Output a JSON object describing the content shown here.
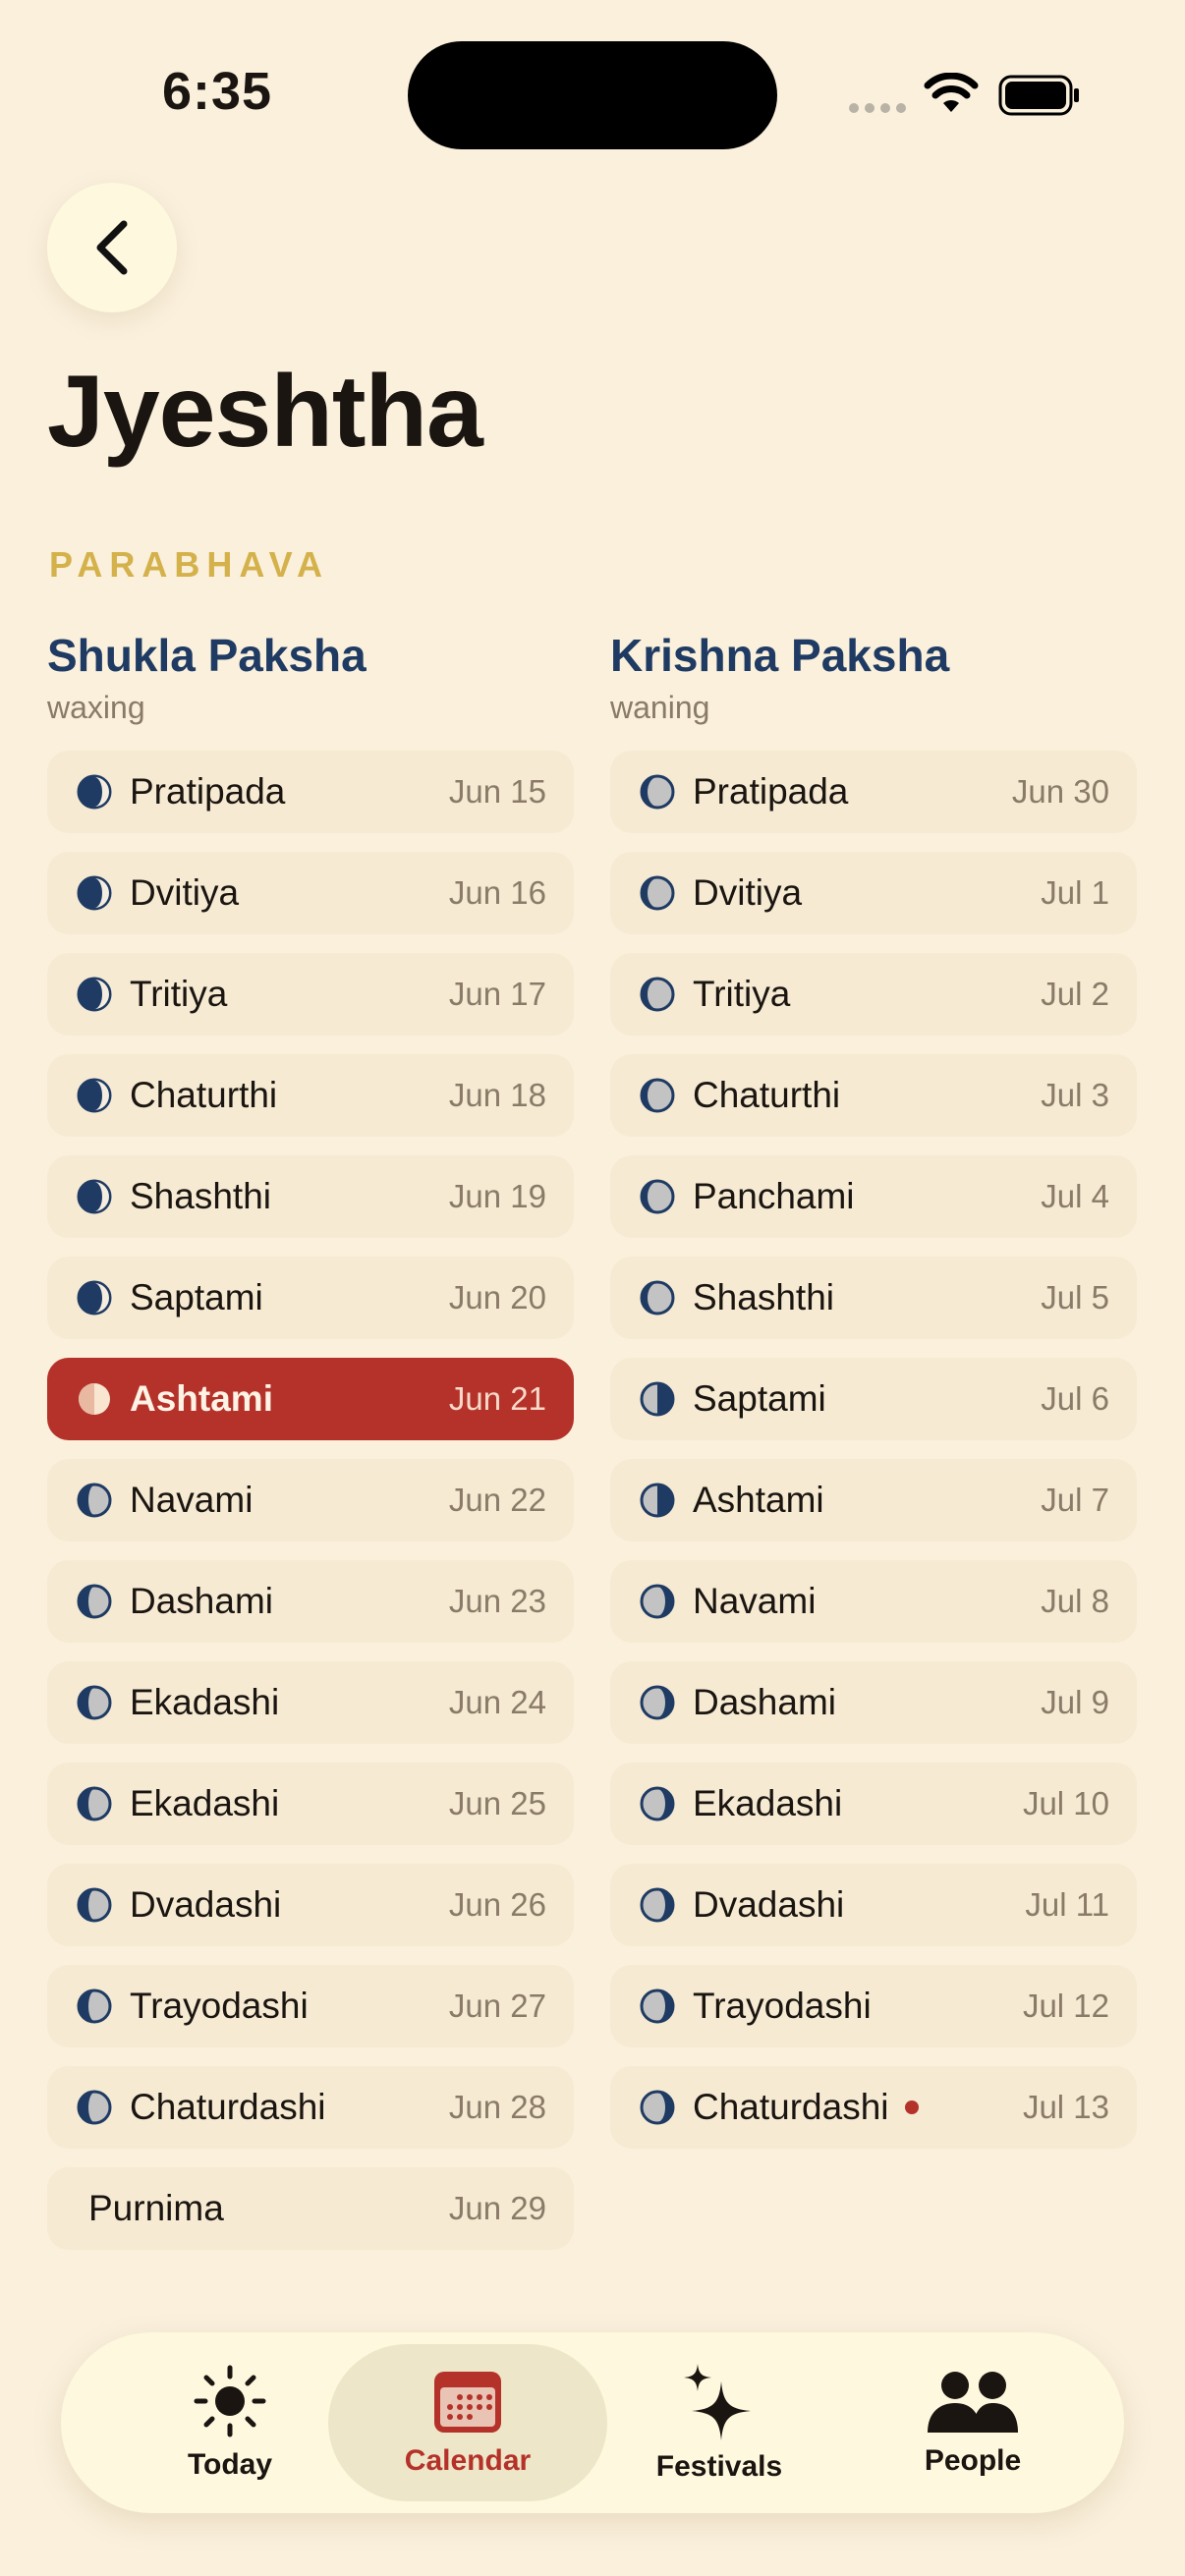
{
  "status_bar": {
    "time": "6:35"
  },
  "header": {
    "title": "Jyeshtha",
    "year_name": "PARABHAVA"
  },
  "shukla": {
    "title": "Shukla Paksha",
    "subtitle": "waxing",
    "items": [
      {
        "name": "Pratipada",
        "date": "Jun 15"
      },
      {
        "name": "Dvitiya",
        "date": "Jun 16"
      },
      {
        "name": "Tritiya",
        "date": "Jun 17"
      },
      {
        "name": "Chaturthi",
        "date": "Jun 18"
      },
      {
        "name": "Shashthi",
        "date": "Jun 19"
      },
      {
        "name": "Saptami",
        "date": "Jun 20"
      },
      {
        "name": "Ashtami",
        "date": "Jun 21"
      },
      {
        "name": "Navami",
        "date": "Jun 22"
      },
      {
        "name": "Dashami",
        "date": "Jun 23"
      },
      {
        "name": "Ekadashi",
        "date": "Jun 24"
      },
      {
        "name": "Ekadashi",
        "date": "Jun 25"
      },
      {
        "name": "Dvadashi",
        "date": "Jun 26"
      },
      {
        "name": "Trayodashi",
        "date": "Jun 27"
      },
      {
        "name": "Chaturdashi",
        "date": "Jun 28"
      },
      {
        "name": "Purnima",
        "date": "Jun 29"
      }
    ]
  },
  "krishna": {
    "title": "Krishna Paksha",
    "subtitle": "waning",
    "items": [
      {
        "name": "Pratipada",
        "date": "Jun 30"
      },
      {
        "name": "Dvitiya",
        "date": "Jul 1"
      },
      {
        "name": "Tritiya",
        "date": "Jul 2"
      },
      {
        "name": "Chaturthi",
        "date": "Jul 3"
      },
      {
        "name": "Panchami",
        "date": "Jul 4"
      },
      {
        "name": "Shashthi",
        "date": "Jul 5"
      },
      {
        "name": "Saptami",
        "date": "Jul 6"
      },
      {
        "name": "Ashtami",
        "date": "Jul 7"
      },
      {
        "name": "Navami",
        "date": "Jul 8"
      },
      {
        "name": "Dashami",
        "date": "Jul 9"
      },
      {
        "name": "Ekadashi",
        "date": "Jul 10"
      },
      {
        "name": "Dvadashi",
        "date": "Jul 11"
      },
      {
        "name": "Trayodashi",
        "date": "Jul 12"
      },
      {
        "name": "Chaturdashi",
        "date": "Jul 13"
      }
    ]
  },
  "tabs": [
    {
      "label": "Today",
      "icon": "sun-icon"
    },
    {
      "label": "Calendar",
      "icon": "calendar-icon"
    },
    {
      "label": "Festivals",
      "icon": "sparkle-icon"
    },
    {
      "label": "People",
      "icon": "people-icon"
    }
  ],
  "colors": {
    "background": "#FAF0DC",
    "accent": "#B4322A",
    "paksha_title": "#1F3B63",
    "year_gold": "#D4B14A"
  }
}
